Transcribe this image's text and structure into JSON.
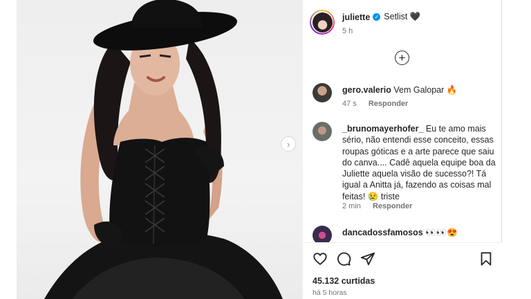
{
  "post": {
    "username": "juliette",
    "verified_symbol": "✓",
    "caption": "Setlist 🖤",
    "time": "5 h",
    "next_symbol": "›",
    "add_symbol": "+"
  },
  "comments": [
    {
      "username": "gero.valerio",
      "text": "Vem Galopar 🔥",
      "time": "47 s",
      "reply_label": "Responder"
    },
    {
      "username": "_brunomayerhofer_",
      "text": "Eu te amo mais sério, não entendi esse conceito, essas roupas góticas e a arte parece que saiu do canva.... Cadê aquela equipe boa da Juliette aquela visão de sucesso?! Tá igual a Anitta já, fazendo as coisas mal feitas! 😢 triste",
      "time": "2 min",
      "reply_label": "Responder"
    },
    {
      "username": "dancadossfamosos",
      "text": "👀👀😍"
    }
  ],
  "footer": {
    "likes": "45.132 curtidas",
    "ago": "há 5 horas"
  },
  "icons": {
    "like": "heart-icon",
    "comment": "comment-icon",
    "share": "send-icon",
    "save": "bookmark-icon"
  },
  "colors": {
    "verified": "#0095f6",
    "secondary_text": "#737373",
    "primary_text": "#262626"
  }
}
